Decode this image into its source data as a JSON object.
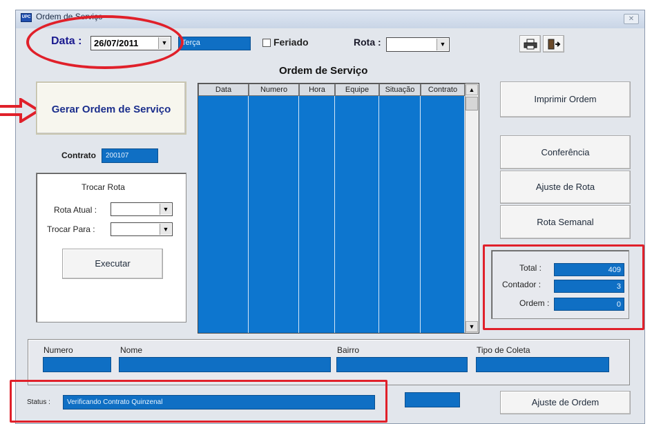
{
  "window": {
    "title": "Ordem de Serviço",
    "icon_text": "UPC",
    "close_glyph": "✕"
  },
  "top": {
    "data_label": "Data :",
    "date_value": "26/07/2011",
    "weekday_value": "Terça",
    "feriado_label": "Feriado",
    "rota_label": "Rota :",
    "rota_value": ""
  },
  "toolbar_icons": [
    "printer-icon",
    "exit-door-icon"
  ],
  "left": {
    "gerar_label": "Gerar Ordem de Serviço",
    "contrato_label": "Contrato",
    "contrato_value": "200107",
    "trocar_rota_title": "Trocar Rota",
    "rota_atual_label": "Rota Atual :",
    "trocar_para_label": "Trocar Para :",
    "executar_label": "Executar"
  },
  "grid": {
    "title": "Ordem de Serviço",
    "columns": [
      "Data",
      "Numero",
      "Hora",
      "Equipe",
      "Situação",
      "Contrato"
    ],
    "rows": []
  },
  "right": {
    "imprimir_label": "Imprimir Ordem",
    "conferencia_label": "Conferência",
    "ajuste_rota_label": "Ajuste de Rota",
    "rota_semanal_label": "Rota Semanal",
    "total_label": "Total :",
    "total_value": "409",
    "contador_label": "Contador :",
    "contador_value": "3",
    "ordem_label": "Ordem :",
    "ordem_value": "0"
  },
  "details": {
    "numero_label": "Numero",
    "nome_label": "Nome",
    "bairro_label": "Bairro",
    "tipo_coleta_label": "Tipo de Coleta"
  },
  "status": {
    "label": "Status :",
    "value": "Verificando Contrato Quinzenal",
    "ajuste_ordem_label": "Ajuste de Ordem"
  },
  "annotation_color": "#e0202a",
  "field_color": "#0f6fc4"
}
